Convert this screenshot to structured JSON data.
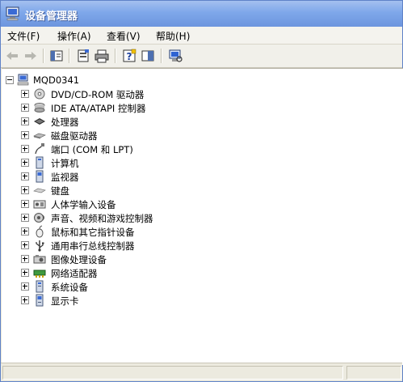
{
  "window": {
    "title": "设备管理器",
    "icon": "computer-icon"
  },
  "menu": [
    {
      "label": "文件(F)"
    },
    {
      "label": "操作(A)"
    },
    {
      "label": "查看(V)"
    },
    {
      "label": "帮助(H)"
    }
  ],
  "toolbar": {
    "buttons": [
      "back-arrow-icon",
      "forward-arrow-icon",
      "show-hide-console-tree-icon",
      "properties-icon",
      "print-icon",
      "help-icon",
      "console-pane-icon",
      "scan-hardware-icon"
    ]
  },
  "tree": {
    "root": {
      "label": "MQD0341",
      "icon": "computer-icon",
      "expanded": true
    },
    "categories": [
      {
        "label": "DVD/CD-ROM 驱动器",
        "icon": "cdrom-icon"
      },
      {
        "label": "IDE ATA/ATAPI 控制器",
        "icon": "ide-controller-icon"
      },
      {
        "label": "处理器",
        "icon": "processor-icon"
      },
      {
        "label": "磁盘驱动器",
        "icon": "disk-drive-icon"
      },
      {
        "label": "端口 (COM 和 LPT)",
        "icon": "port-icon"
      },
      {
        "label": "计算机",
        "icon": "computer-small-icon"
      },
      {
        "label": "监视器",
        "icon": "monitor-icon"
      },
      {
        "label": "键盘",
        "icon": "keyboard-icon"
      },
      {
        "label": "人体学输入设备",
        "icon": "hid-icon"
      },
      {
        "label": "声音、视频和游戏控制器",
        "icon": "sound-icon"
      },
      {
        "label": "鼠标和其它指针设备",
        "icon": "mouse-icon"
      },
      {
        "label": "通用串行总线控制器",
        "icon": "usb-icon"
      },
      {
        "label": "图像处理设备",
        "icon": "imaging-icon"
      },
      {
        "label": "网络适配器",
        "icon": "network-adapter-icon"
      },
      {
        "label": "系统设备",
        "icon": "system-device-icon"
      },
      {
        "label": "显示卡",
        "icon": "display-adapter-icon"
      }
    ]
  },
  "colors": {
    "titlebar": "#7ea7ea",
    "tree_background": "#ffffff",
    "chrome": "#f1f0ea"
  }
}
